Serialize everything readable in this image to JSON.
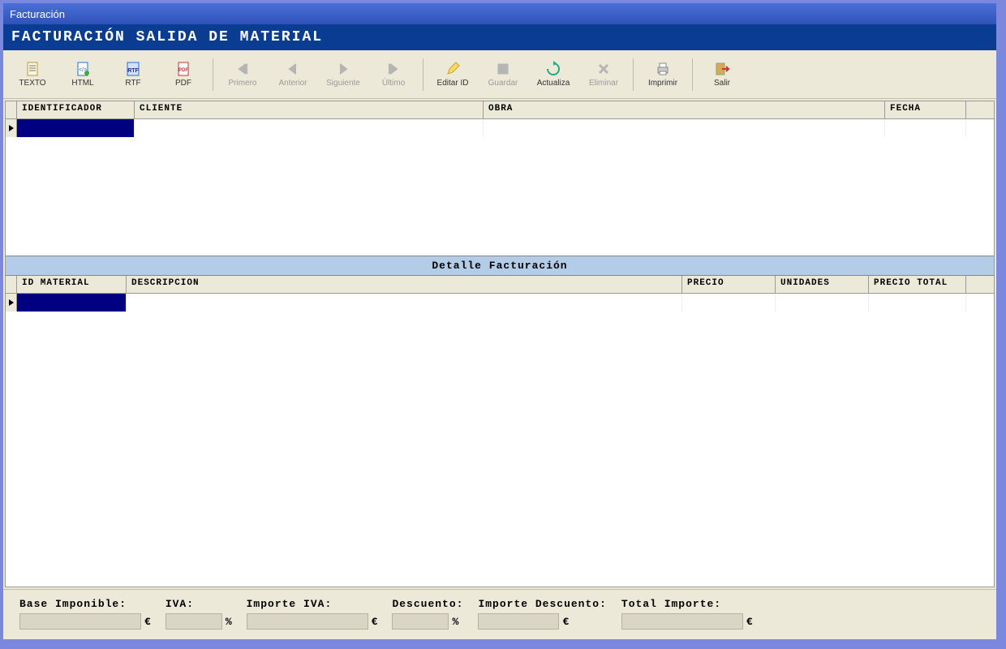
{
  "window_title": "Facturación",
  "section_title": "FACTURACIÓN SALIDA DE MATERIAL",
  "toolbar": [
    {
      "id": "texto",
      "label": "TEXTO",
      "icon": "doc-text",
      "enabled": true
    },
    {
      "id": "html",
      "label": "HTML",
      "icon": "doc-html",
      "enabled": true
    },
    {
      "id": "rtf",
      "label": "RTF",
      "icon": "doc-rtf",
      "enabled": true
    },
    {
      "id": "pdf",
      "label": "PDF",
      "icon": "doc-pdf",
      "enabled": true
    },
    {
      "sep": true
    },
    {
      "id": "primero",
      "label": "Primero",
      "icon": "first",
      "enabled": false
    },
    {
      "id": "anterior",
      "label": "Anterior",
      "icon": "prev",
      "enabled": false
    },
    {
      "id": "siguiente",
      "label": "Siguiente",
      "icon": "next",
      "enabled": false
    },
    {
      "id": "ultimo",
      "label": "Último",
      "icon": "last",
      "enabled": false
    },
    {
      "sep": true
    },
    {
      "id": "editar",
      "label": "Editar ID",
      "icon": "edit",
      "enabled": true
    },
    {
      "id": "guardar",
      "label": "Guardar",
      "icon": "save",
      "enabled": false
    },
    {
      "id": "actualiza",
      "label": "Actualiza",
      "icon": "refresh",
      "enabled": true
    },
    {
      "id": "eliminar",
      "label": "Eliminar",
      "icon": "delete",
      "enabled": false
    },
    {
      "sep": true
    },
    {
      "id": "imprimir",
      "label": "Imprimir",
      "icon": "print",
      "enabled": true
    },
    {
      "sep": true
    },
    {
      "id": "salir",
      "label": "Salir",
      "icon": "exit",
      "enabled": true
    }
  ],
  "grid_top_headers": [
    "IDENTIFICADOR",
    "CLIENTE",
    "OBRA",
    "FECHA"
  ],
  "detail_title": "Detalle Facturación",
  "grid_bottom_headers": [
    "ID MATERIAL",
    "DESCRIPCION",
    "PRECIO",
    "UNIDADES",
    "PRECIO TOTAL"
  ],
  "footer": {
    "base_label": "Base Imponible:",
    "base_unit": "€",
    "iva_label": "IVA:",
    "iva_unit": "%",
    "imp_iva_label": "Importe IVA:",
    "imp_iva_unit": "€",
    "desc_label": "Descuento:",
    "desc_unit": "%",
    "imp_desc_label": "Importe Descuento:",
    "imp_desc_unit": "€",
    "total_label": "Total Importe:",
    "total_unit": "€"
  },
  "grid_top_widths": [
    145,
    430,
    495,
    100
  ],
  "grid_bottom_widths": [
    135,
    685,
    115,
    115,
    120
  ]
}
